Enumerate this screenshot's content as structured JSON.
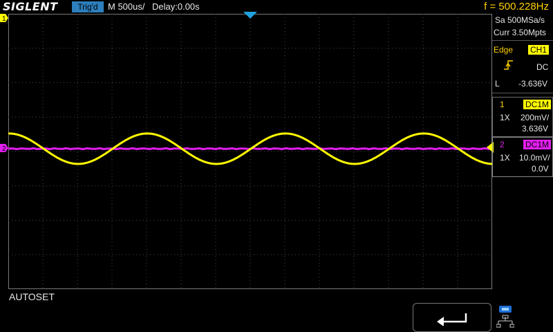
{
  "header": {
    "brand": "SIGLENT",
    "trigger_status": "Trig'd",
    "timebase": "M 500us/",
    "delay": "Delay:0.00s",
    "frequency": "f = 500.228Hz"
  },
  "acquisition": {
    "sample_rate": "Sa 500MSa/s",
    "memory_depth": "Curr 3.50Mpts"
  },
  "trigger": {
    "type": "Edge",
    "source": "CH1",
    "coupling": "DC",
    "level_label": "L",
    "level_value": "-3.636V",
    "slope_icon": "rising-edge-icon"
  },
  "channels": [
    {
      "number": "1",
      "coupling": "DC1M",
      "probe": "1X",
      "scale": "200mV/",
      "offset": "3.636V",
      "color": "#fffb00"
    },
    {
      "number": "2",
      "coupling": "DC1M",
      "probe": "1X",
      "scale": "10.0mV/",
      "offset": "0.0V",
      "color": "#e21ef0"
    }
  ],
  "markers": {
    "ch1": "1",
    "ch2": "2"
  },
  "footer": {
    "last_action": "AUTOSET",
    "return_icon": "return-arrow-icon",
    "network_icon": "network-icon"
  },
  "colors": {
    "ch1": "#fffb00",
    "ch2": "#e21ef0",
    "accent": "#2d7fbd",
    "trigger_marker": "#1fa3e0"
  }
}
